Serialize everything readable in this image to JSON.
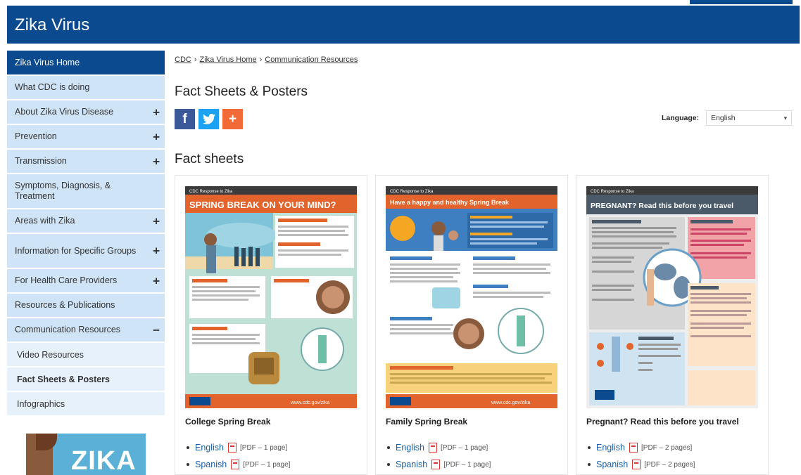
{
  "header": {
    "title": "Zika Virus"
  },
  "sidebar": {
    "items": [
      {
        "label": "Zika Virus Home",
        "expand": ""
      },
      {
        "label": "What CDC is doing",
        "expand": ""
      },
      {
        "label": "About Zika Virus Disease",
        "expand": "+"
      },
      {
        "label": "Prevention",
        "expand": "+"
      },
      {
        "label": "Transmission",
        "expand": "+"
      },
      {
        "label": "Symptoms, Diagnosis, & Treatment",
        "expand": ""
      },
      {
        "label": "Areas with Zika",
        "expand": "+"
      },
      {
        "label": "Information for Specific Groups",
        "expand": "+"
      },
      {
        "label": "For Health Care Providers",
        "expand": "+"
      },
      {
        "label": "Resources & Publications",
        "expand": ""
      },
      {
        "label": "Communication Resources",
        "expand": "−"
      }
    ],
    "subitems": [
      {
        "label": "Video Resources"
      },
      {
        "label": "Fact Sheets & Posters"
      },
      {
        "label": "Infographics"
      }
    ],
    "promo": {
      "text": "ZIKA"
    }
  },
  "breadcrumb": {
    "items": [
      "CDC",
      "Zika Virus Home",
      "Communication Resources"
    ],
    "sep": "›"
  },
  "page": {
    "title": "Fact Sheets & Posters",
    "section": "Fact sheets"
  },
  "social": {
    "facebook": "f",
    "twitter": "t",
    "addthis": "+"
  },
  "language": {
    "label": "Language:",
    "value": "English"
  },
  "cards": [
    {
      "title": "College Spring Break",
      "poster": {
        "kicker": "CDC Response to Zika",
        "headline": "SPRING BREAK ON YOUR MIND?",
        "footer": "www.cdc.gov/zika"
      },
      "links": [
        {
          "lang": "English",
          "meta": "[PDF – 1 page]"
        },
        {
          "lang": "Spanish",
          "meta": "[PDF – 1 page]"
        }
      ]
    },
    {
      "title": "Family Spring Break",
      "poster": {
        "kicker": "CDC Response to Zika",
        "headline": "Have a happy and healthy Spring Break",
        "footer": "www.cdc.gov/zika"
      },
      "links": [
        {
          "lang": "English",
          "meta": "[PDF – 1 page]"
        },
        {
          "lang": "Spanish",
          "meta": "[PDF – 1 page]"
        }
      ]
    },
    {
      "title": "Pregnant? Read this before you travel",
      "poster": {
        "kicker": "CDC Response to Zika",
        "headline": "PREGNANT? Read this before you travel",
        "footer": ""
      },
      "links": [
        {
          "lang": "English",
          "meta": "[PDF – 2 pages]"
        },
        {
          "lang": "Spanish",
          "meta": "[PDF – 2 pages]"
        }
      ]
    }
  ]
}
